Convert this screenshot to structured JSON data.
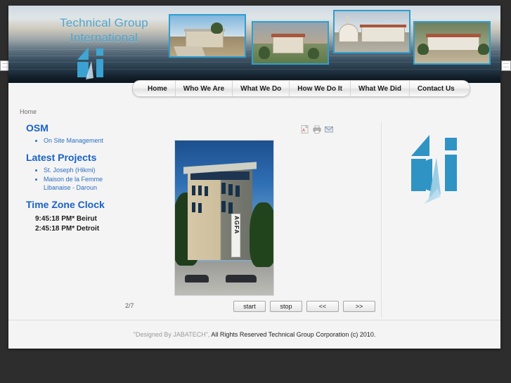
{
  "site": {
    "brand_line1": "Technical Group",
    "brand_line2": "International",
    "logo_alt": "tgi-sailboat-logo"
  },
  "nav": {
    "items": [
      {
        "label": "Home"
      },
      {
        "label": "Who We Are"
      },
      {
        "label": "What We Do"
      },
      {
        "label": "How We Do It"
      },
      {
        "label": "What We Did"
      },
      {
        "label": "Contact Us"
      }
    ]
  },
  "breadcrumb": {
    "current": "Home"
  },
  "sidebar": {
    "sections": [
      {
        "heading": "OSM",
        "items": [
          "On Site Management"
        ]
      },
      {
        "heading": "Latest Projects",
        "items": [
          "St. Joseph (Hikmi)",
          "Maison de la Femme Libanaise - Daroun"
        ]
      }
    ],
    "clock": {
      "heading": "Time Zone Clock",
      "rows": [
        {
          "time": "9:45:18 PM*",
          "city": "Beirut"
        },
        {
          "time": "2:45:18 PM*",
          "city": "Detroit"
        }
      ]
    }
  },
  "main": {
    "tools": [
      {
        "name": "pdf-icon",
        "title": "PDF"
      },
      {
        "name": "print-icon",
        "title": "Print"
      },
      {
        "name": "email-icon",
        "title": "E-mail"
      }
    ],
    "slideshow": {
      "counter": "2/7",
      "image_alt": "office-building-photo",
      "banner_text": "AGFA",
      "controls": [
        {
          "label": "start",
          "name": "slideshow-start-button"
        },
        {
          "label": "stop",
          "name": "slideshow-stop-button"
        },
        {
          "label": "<<",
          "name": "slideshow-prev-button"
        },
        {
          "label": ">>",
          "name": "slideshow-next-button"
        }
      ]
    }
  },
  "footer": {
    "designer": "\"Designed By JABATECH\",",
    "rights": " All Rights Reserved Technical Group Corporation (c) 2010."
  },
  "colors": {
    "accent_blue": "#2e9fd0",
    "heading_blue": "#1862c6",
    "link_blue": "#2b6fc2",
    "page_bg": "#f4f4f4",
    "backdrop": "#2d2d2d"
  }
}
